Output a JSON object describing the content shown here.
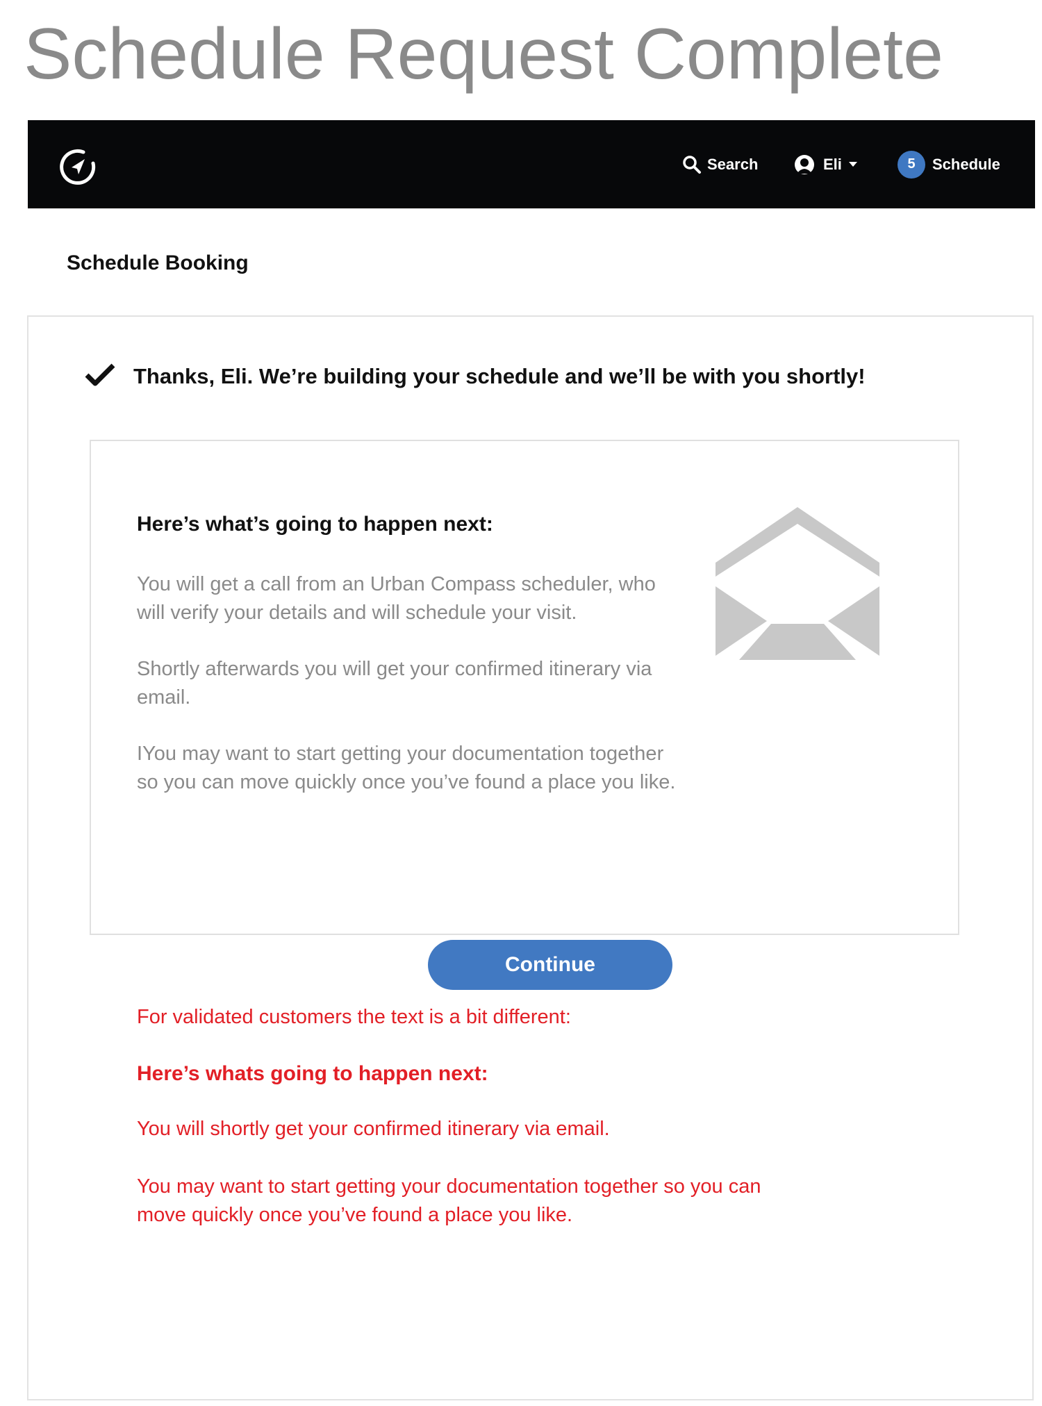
{
  "page": {
    "title": "Schedule Request Complete"
  },
  "navbar": {
    "logo_icon": "compass-logo-icon",
    "search_label": "Search",
    "search_icon": "search-icon",
    "user_label": "Eli",
    "user_icon": "user-avatar-icon",
    "user_menu_icon": "caret-down-icon",
    "schedule_count": "5",
    "schedule_label": "Schedule"
  },
  "section": {
    "heading": "Schedule Booking"
  },
  "confirmation": {
    "icon": "checkmark-icon",
    "message": "Thanks, Eli. We’re building your schedule and we’ll be with you shortly!"
  },
  "next_steps": {
    "heading": "Here’s what’s going to happen next:",
    "paragraphs": [
      "You will get a call from an Urban Compass scheduler, who will verify your details and will schedule your visit.",
      "Shortly afterwards you will get your confirmed itinerary via email.",
      "IYou may want to start getting your documentation together so you can move quickly once you’ve found a place you like."
    ],
    "illustration_icon": "open-envelope-icon"
  },
  "actions": {
    "continue_label": "Continue"
  },
  "annotation": {
    "intro": "For validated customers the text is a bit different:",
    "heading": "Here’s whats going to happen next:",
    "paragraphs": [
      "You will shortly get your confirmed itinerary via email.",
      "You may want to start getting your documentation together so you can move quickly once you’ve found a place you like."
    ]
  },
  "colors": {
    "navbar_background": "#07080a",
    "accent_blue": "#4179c2",
    "annotation_red": "#e21f26",
    "muted_text": "#8a8a8a"
  }
}
